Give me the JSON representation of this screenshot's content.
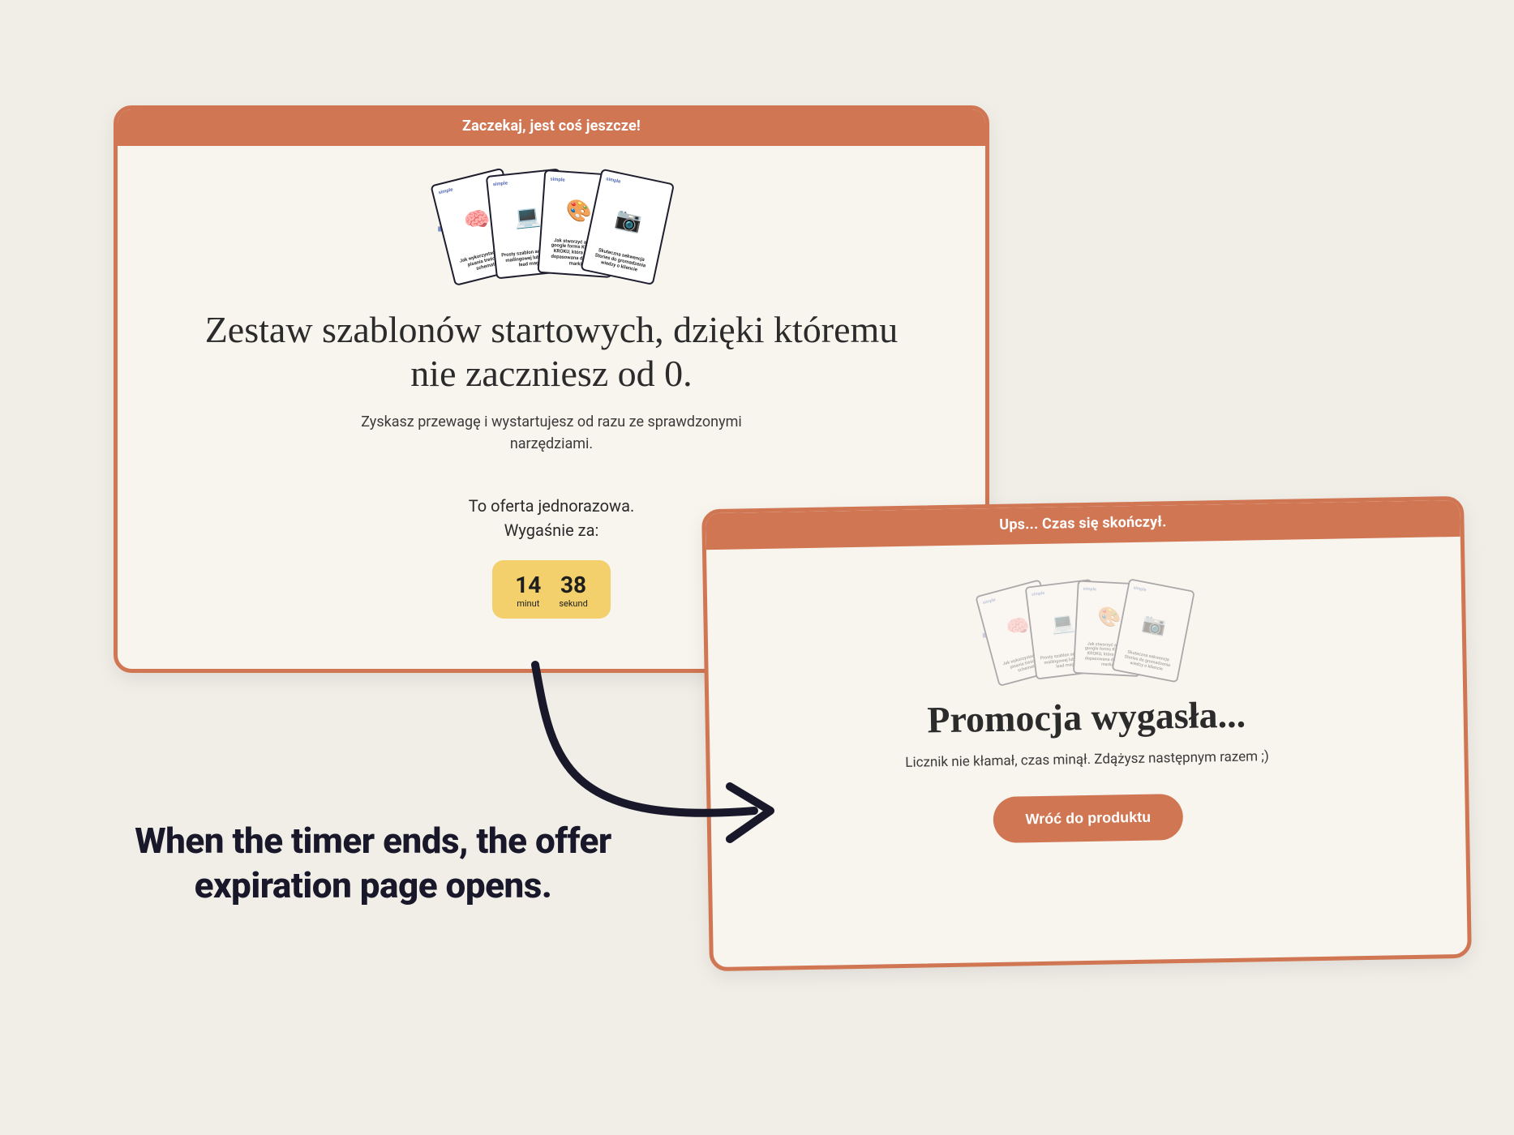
{
  "window1": {
    "header": "Zaczekaj, jest coś jeszcze!",
    "heading": "Zestaw szablonów startowych, dzięki któremu nie zaczniesz od 0.",
    "subtext": "Zyskasz przewagę i wystartujesz od razu ze sprawdzonymi narzędziami.",
    "offer_line1": "To oferta jednorazowa.",
    "offer_line2": "Wygaśnie za:",
    "timer": {
      "minutes_value": "14",
      "minutes_label": "minut",
      "seconds_value": "38",
      "seconds_label": "sekund"
    },
    "cards": {
      "logo": "simple",
      "c1": {
        "caption": "Jak wykorzystać chat do pisania treści oraz schematów"
      },
      "c2": {
        "caption": "Prosty szablon ankiety listy mailingowej lub szablon lead magnet"
      },
      "c3": {
        "caption": "Jak stworzyć ankietę google forms KROK PO KROKU, która będzie dopasowana do swojej marki"
      },
      "c4": {
        "caption": "Skuteczna sekwencja Stories do gromadzenia wiedzy o kliencie"
      }
    }
  },
  "window2": {
    "header": "Ups... Czas się skończył.",
    "heading": "Promocja wygasła...",
    "subtext": "Licznik nie kłamał, czas minął. Zdążysz następnym razem ;)",
    "cta": "Wróć do produktu"
  },
  "annotation": "When the timer ends, the offer expiration page opens.",
  "colors": {
    "accent": "#d07653",
    "timer_bg": "#f3d06b",
    "plus": "#7a8dc8",
    "dark": "#18182a"
  }
}
